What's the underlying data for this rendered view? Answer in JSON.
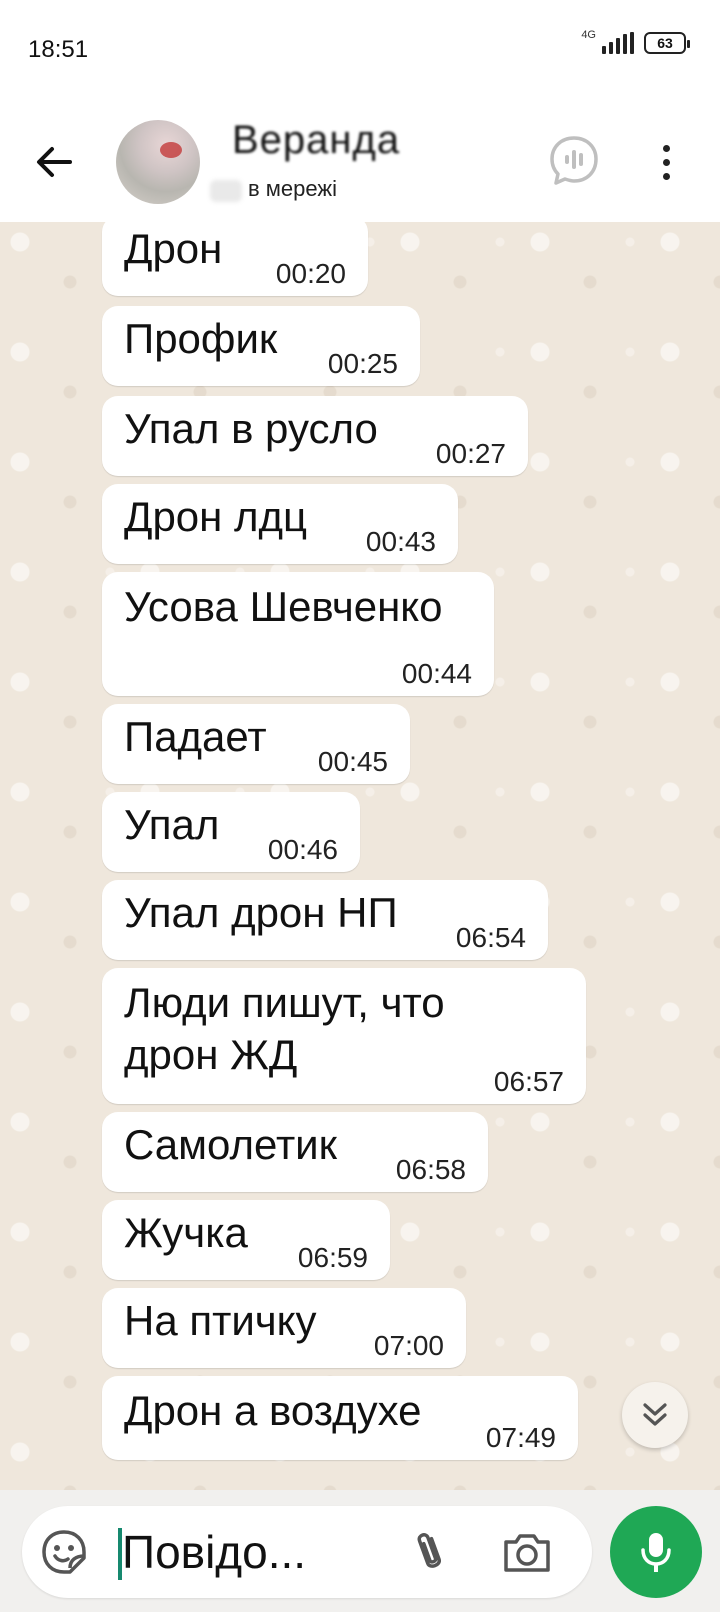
{
  "status_bar": {
    "time": "18:51",
    "network": "4G",
    "battery": "63"
  },
  "header": {
    "contact_name": "Веранда",
    "contact_status": "в мережі"
  },
  "messages": [
    {
      "text": "Дрон",
      "time": "00:20"
    },
    {
      "text": "Профик",
      "time": "00:25"
    },
    {
      "text": "Упал в русло",
      "time": "00:27"
    },
    {
      "text": "Дрон лдц",
      "time": "00:43"
    },
    {
      "text": "Усова Шевченко",
      "time": "00:44"
    },
    {
      "text": "Падает",
      "time": "00:45"
    },
    {
      "text": "Упал",
      "time": "00:46"
    },
    {
      "text": "Упал дрон НП",
      "time": "06:54"
    },
    {
      "text": "Люди пишут, что",
      "text2": "дрон ЖД",
      "time": "06:57"
    },
    {
      "text": "Самолетик",
      "time": "06:58"
    },
    {
      "text": "Жучка",
      "time": "06:59"
    },
    {
      "text": "На птичку",
      "time": "07:00"
    },
    {
      "text": "Дрон а воздухе",
      "time": "07:49"
    }
  ],
  "composer": {
    "placeholder": "Повідо..."
  },
  "colors": {
    "accent": "#1fa855",
    "chat_bg": "#efe7dc",
    "bubble": "#ffffff"
  },
  "icons": [
    "back-arrow-icon",
    "voice-chat-icon",
    "more-vert-icon",
    "sticker-icon",
    "attach-icon",
    "camera-icon",
    "mic-icon",
    "double-chevron-down-icon"
  ]
}
